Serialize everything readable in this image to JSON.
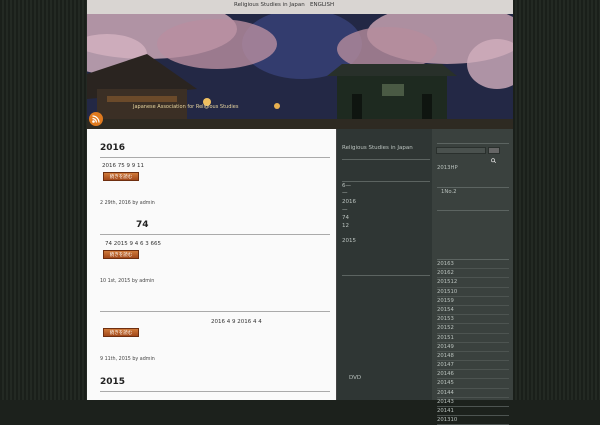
{
  "nav": {
    "items": [
      "Religious Studies in Japan",
      "ENGLISH"
    ]
  },
  "header": {
    "description": "Japanese Association for Religious Studies"
  },
  "posts": [
    {
      "title": "2016",
      "excerpt": "2016          75          9  9          11",
      "more_label": "続きを読む",
      "meta": "2 29th, 2016 by admin"
    },
    {
      "title": "74",
      "excerpt": "74                    2015                    9  4     6     3                                                              665",
      "more_label": "続きを読む",
      "meta": "10 1st, 2015 by admin"
    },
    {
      "title": "",
      "excerpt": "2016   4   9               2016   4   4",
      "more_label": "続きを読む",
      "meta": "9 11th, 2015 by admin"
    },
    {
      "title": "2015",
      "excerpt": "",
      "more_label": "",
      "meta": ""
    }
  ],
  "sidebar1": {
    "heading": "Religious Studies in Japan",
    "items": [
      "6—",
      "—",
      "2016",
      "—",
      "74",
      "12",
      "2015"
    ],
    "bottom": "DVD"
  },
  "sidebar2": {
    "search_placeholder": "",
    "link1": "2013HP",
    "link2": "1No.2",
    "archives": [
      "20163",
      "20162",
      "201512",
      "201510",
      "20159",
      "20154",
      "20153",
      "20152",
      "20151",
      "20149",
      "20148",
      "20147",
      "20146",
      "20145",
      "20144",
      "20143",
      "20141",
      "201310"
    ]
  },
  "colors": {
    "button": "#b85a26",
    "main_bg": "#fafafa",
    "sidebar_bg": "#2f3634"
  }
}
